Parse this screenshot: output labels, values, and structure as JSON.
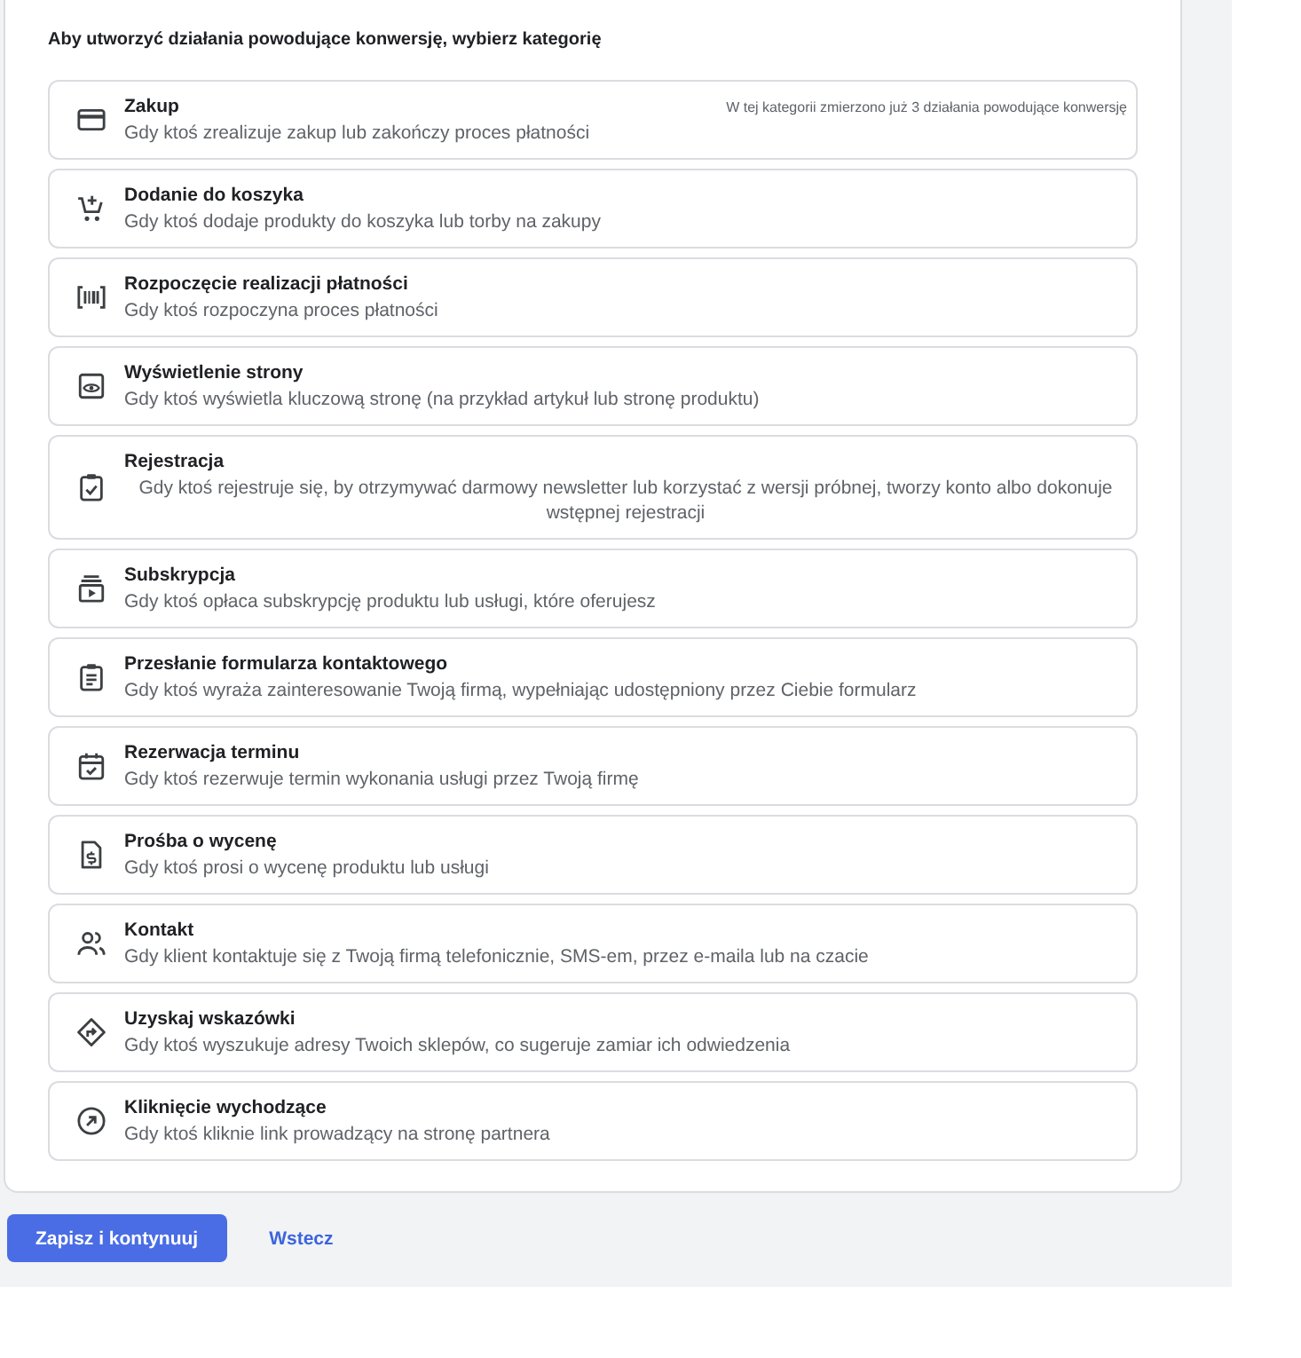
{
  "heading": "Aby utworzyć działania powodujące konwersję, wybierz kategorię",
  "categories": [
    {
      "title": "Zakup",
      "description": "Gdy ktoś zrealizuje zakup lub zakończy proces płatności",
      "note": "W tej kategorii zmierzono już 3 działania powodujące konwersję"
    },
    {
      "title": "Dodanie do koszyka",
      "description": "Gdy ktoś dodaje produkty do koszyka lub torby na zakupy"
    },
    {
      "title": "Rozpoczęcie realizacji płatności",
      "description": "Gdy ktoś rozpoczyna proces płatności"
    },
    {
      "title": "Wyświetlenie strony",
      "description": "Gdy ktoś wyświetla kluczową stronę (na przykład artykuł lub stronę produktu)"
    },
    {
      "title": "Rejestracja",
      "description": "Gdy ktoś rejestruje się, by otrzymywać darmowy newsletter lub korzystać z wersji próbnej, tworzy konto albo dokonuje wstępnej rejestracji"
    },
    {
      "title": "Subskrypcja",
      "description": "Gdy ktoś opłaca subskrypcję produktu lub usługi, które oferujesz"
    },
    {
      "title": "Przesłanie formularza kontaktowego",
      "description": "Gdy ktoś wyraża zainteresowanie Twoją firmą, wypełniając udostępniony przez Ciebie formularz"
    },
    {
      "title": "Rezerwacja terminu",
      "description": "Gdy ktoś rezerwuje termin wykonania usługi przez Twoją firmę"
    },
    {
      "title": "Prośba o wycenę",
      "description": "Gdy ktoś prosi o wycenę produktu lub usługi"
    },
    {
      "title": "Kontakt",
      "description": "Gdy klient kontaktuje się z Twoją firmą telefonicznie, SMS-em, przez e-maila lub na czacie"
    },
    {
      "title": "Uzyskaj wskazówki",
      "description": "Gdy ktoś wyszukuje adresy Twoich sklepów, co sugeruje zamiar ich odwiedzenia"
    },
    {
      "title": "Kliknięcie wychodzące",
      "description": "Gdy ktoś kliknie link prowadzący na stronę partnera"
    }
  ],
  "actions": [
    {
      "label": "Zapisz i kontynuuj",
      "kind": "primary"
    },
    {
      "label": "Wstecz",
      "kind": "link"
    }
  ]
}
